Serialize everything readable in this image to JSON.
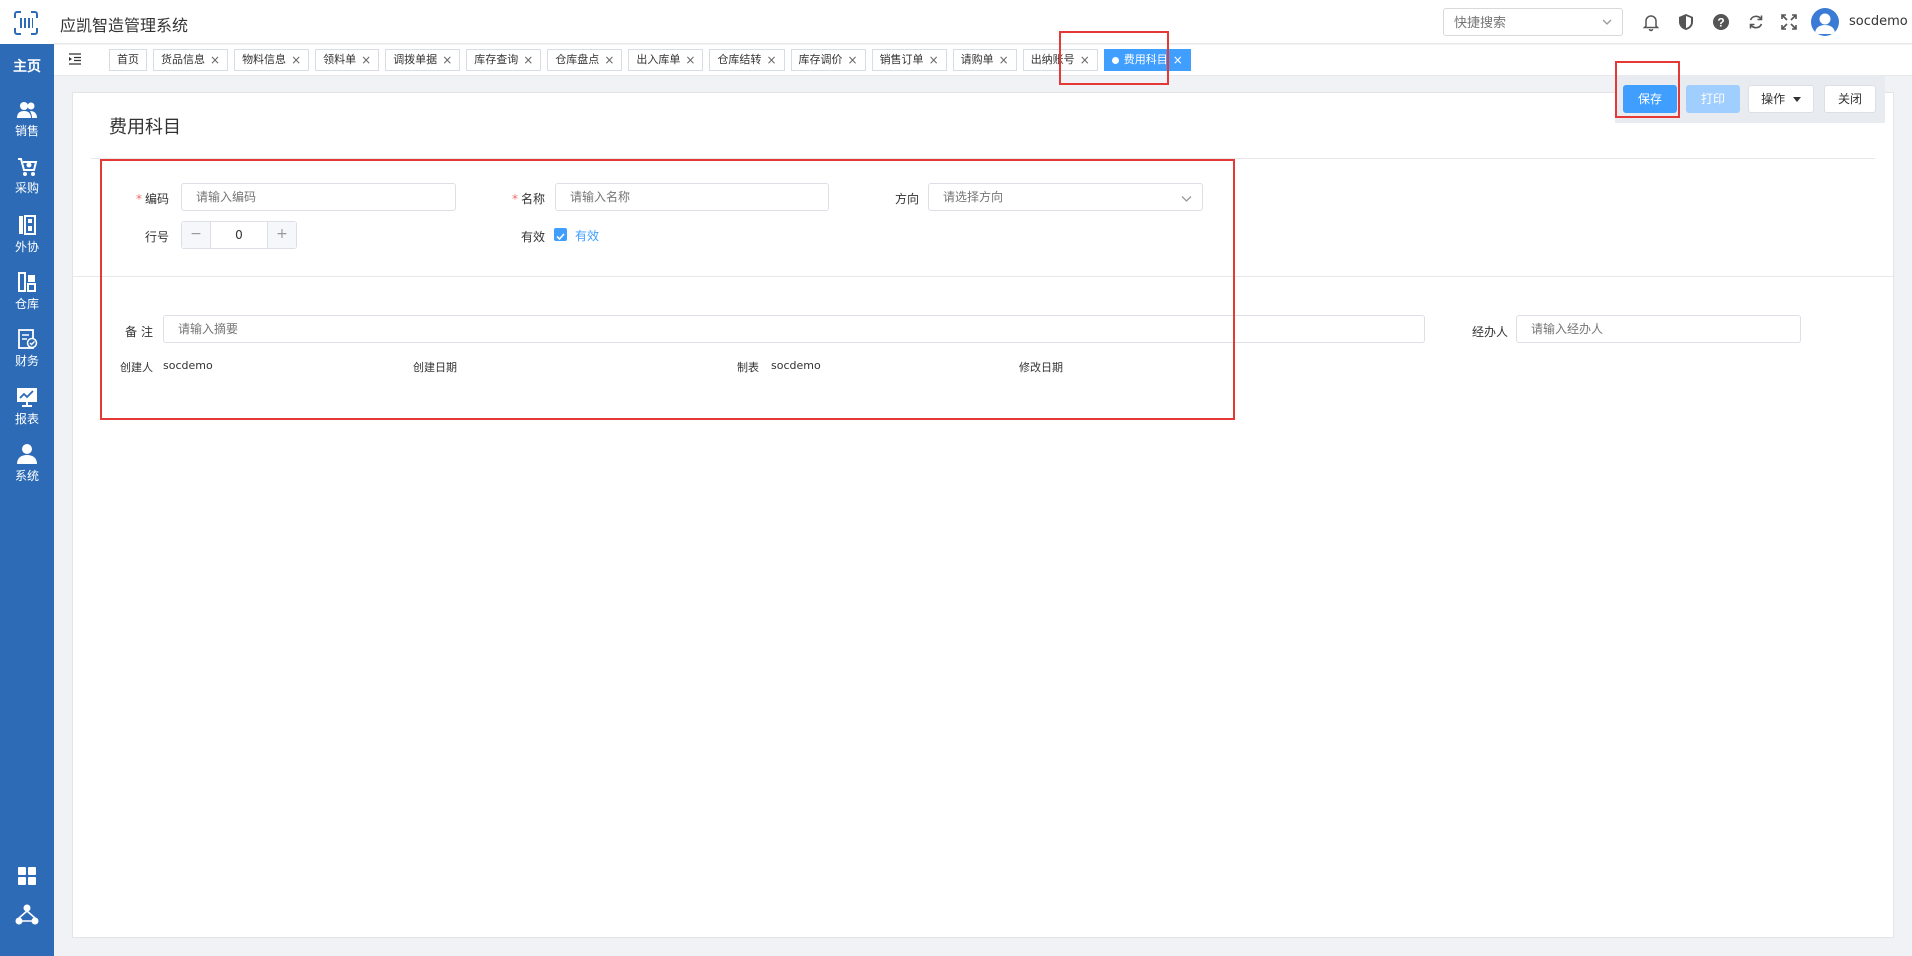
{
  "app": {
    "title": "应凯智造管理系统"
  },
  "header": {
    "search_placeholder": "快捷搜索",
    "username": "socdemo",
    "icons": [
      "bell-icon",
      "shield-icon",
      "help-icon",
      "refresh-icon",
      "fullscreen-icon"
    ]
  },
  "sidebar": {
    "home": "主页",
    "items": [
      {
        "label": "销售",
        "icon": "users-icon"
      },
      {
        "label": "采购",
        "icon": "cart-icon"
      },
      {
        "label": "外协",
        "icon": "outsource-icon"
      },
      {
        "label": "仓库",
        "icon": "warehouse-icon"
      },
      {
        "label": "财务",
        "icon": "finance-icon"
      },
      {
        "label": "报表",
        "icon": "report-icon"
      },
      {
        "label": "系统",
        "icon": "user-icon"
      }
    ]
  },
  "tabs": [
    {
      "label": "首页",
      "closable": false,
      "active": false
    },
    {
      "label": "货品信息",
      "closable": true,
      "active": false
    },
    {
      "label": "物料信息",
      "closable": true,
      "active": false
    },
    {
      "label": "领料单",
      "closable": true,
      "active": false
    },
    {
      "label": "调拨单据",
      "closable": true,
      "active": false
    },
    {
      "label": "库存查询",
      "closable": true,
      "active": false
    },
    {
      "label": "仓库盘点",
      "closable": true,
      "active": false
    },
    {
      "label": "出入库单",
      "closable": true,
      "active": false
    },
    {
      "label": "仓库结转",
      "closable": true,
      "active": false
    },
    {
      "label": "库存调价",
      "closable": true,
      "active": false
    },
    {
      "label": "销售订单",
      "closable": true,
      "active": false
    },
    {
      "label": "请购单",
      "closable": true,
      "active": false
    },
    {
      "label": "出纳账号",
      "closable": true,
      "active": false
    },
    {
      "label": "费用科目",
      "closable": true,
      "active": true
    }
  ],
  "toolbar": {
    "save": "保存",
    "print": "打印",
    "operate": "操作",
    "close": "关闭"
  },
  "form": {
    "title": "费用科目",
    "code_label": "编码",
    "code_placeholder": "请输入编码",
    "name_label": "名称",
    "name_placeholder": "请输入名称",
    "direction_label": "方向",
    "direction_placeholder": "请选择方向",
    "line_label": "行号",
    "line_value": "0",
    "valid_label": "有效",
    "valid_check_label": "有效",
    "valid_checked": true,
    "remark_label": "备 注",
    "remark_placeholder": "请输入摘要",
    "handler_label": "经办人",
    "handler_placeholder": "请输入经办人",
    "creator_label": "创建人",
    "creator_value": "socdemo",
    "create_date_label": "创建日期",
    "create_date_value": "",
    "maker_label": "制表",
    "maker_value": "socdemo",
    "modify_date_label": "修改日期",
    "modify_date_value": ""
  },
  "colors": {
    "sidebar": "#2d6bb7",
    "primary": "#409eff",
    "highlight": "#e53935",
    "required": "#f56c6c"
  }
}
